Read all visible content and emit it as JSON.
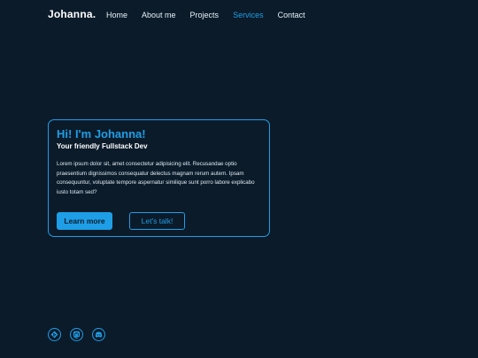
{
  "brand": {
    "logo": "Johanna."
  },
  "nav": {
    "items": [
      {
        "label": "Home"
      },
      {
        "label": "About me"
      },
      {
        "label": "Projects"
      },
      {
        "label": "Services"
      },
      {
        "label": "Contact"
      }
    ],
    "active_item": "Services"
  },
  "hero": {
    "greeting": "Hi! I'm Johanna!",
    "subtitle": "Your friendly Fullstack Dev",
    "description": "Lorem ipsum dolor sit, amet consectetur adipisicing elit. Recusandae optio praesentium dignissimos consequatur delectus magnam rerum autem. Ipsam consequuntur, voluptate tempore aspernatur similique sunt porro labore explicabo iusto totam sed?",
    "primary_button": "Learn more",
    "secondary_button": "Let's talk!"
  },
  "socials": [
    {
      "icon": "git-icon"
    },
    {
      "icon": "mastodon-icon"
    },
    {
      "icon": "discord-icon"
    }
  ],
  "colors": {
    "background": "#0b1b2a",
    "accent": "#1e9ee6",
    "text": "#e8f1f8"
  }
}
